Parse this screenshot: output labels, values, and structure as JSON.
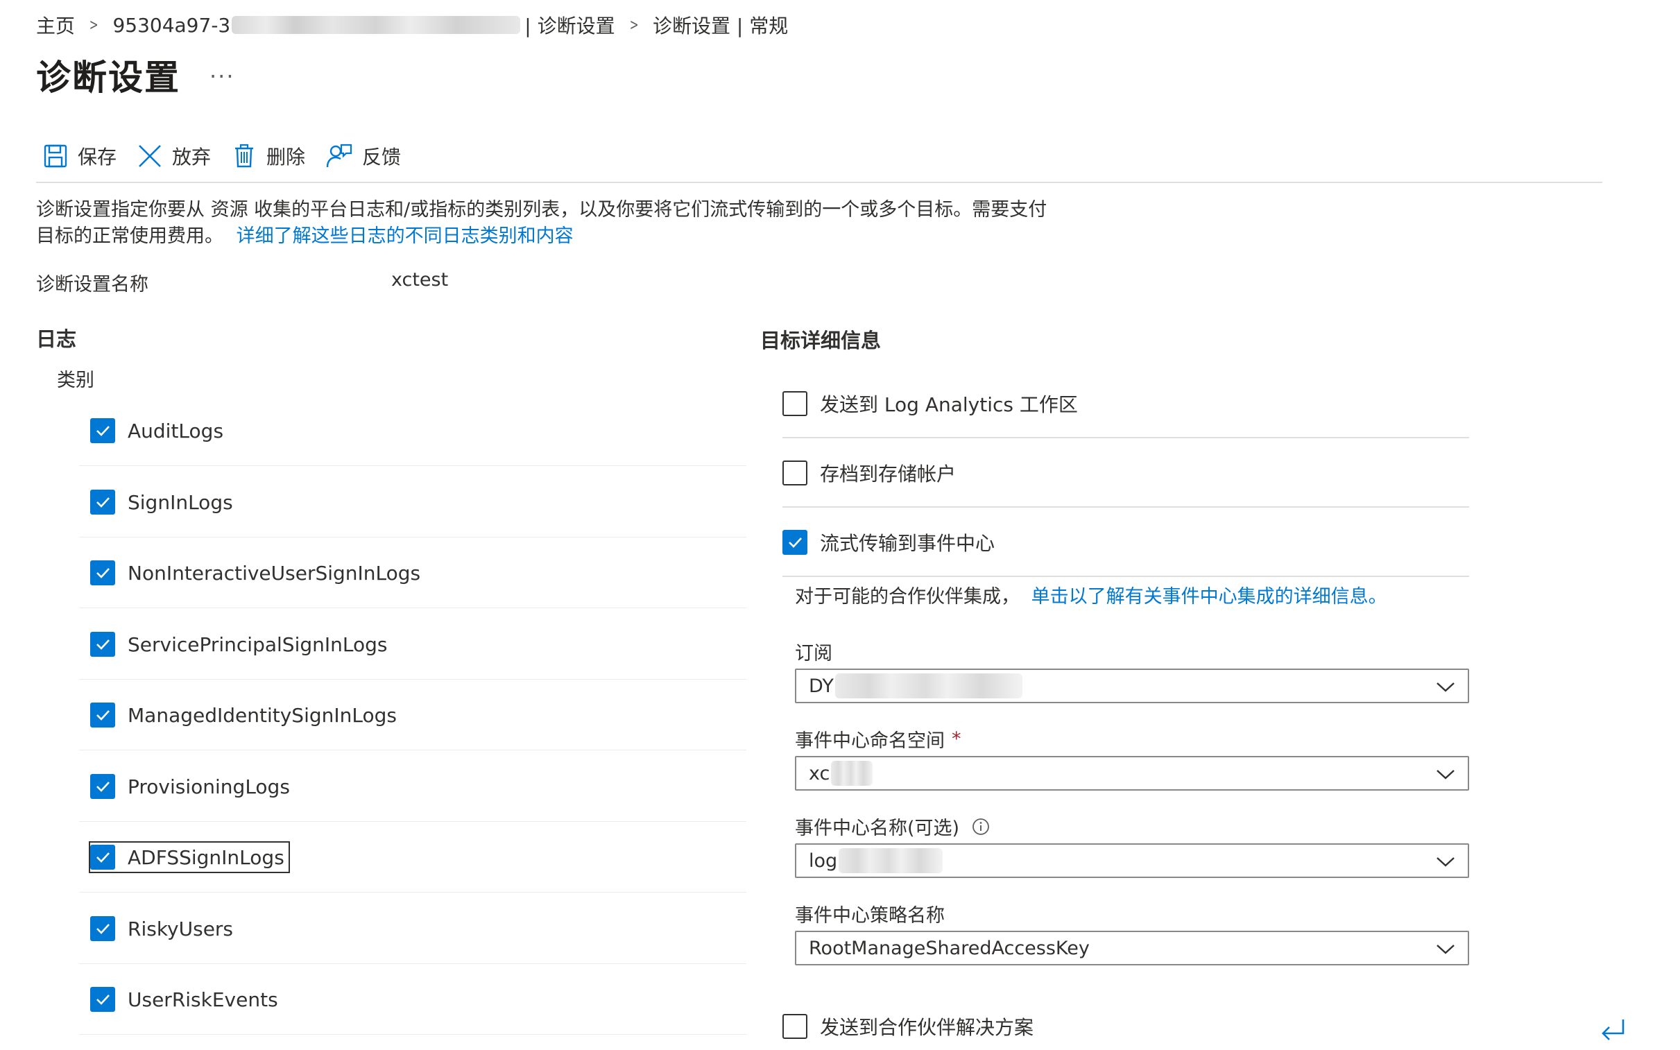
{
  "breadcrumb": {
    "home": "主页",
    "resource_prefix": "95304a97-3",
    "resource_suffix": "| 诊断设置",
    "current": "诊断设置 | 常规"
  },
  "page": {
    "title": "诊断设置",
    "more": "..."
  },
  "toolbar": {
    "save": "保存",
    "discard": "放弃",
    "delete": "删除",
    "feedback": "反馈"
  },
  "description": {
    "text": "诊断设置指定你要从 资源 收集的平台日志和/或指标的类别列表，以及你要将它们流式传输到的一个或多个目标。需要支付目标的正常使用费用。",
    "link": "详细了解这些日志的不同日志类别和内容"
  },
  "setting_name": {
    "label": "诊断设置名称",
    "value": "xctest"
  },
  "logs": {
    "title": "日志",
    "category_label": "类别",
    "items": [
      {
        "label": "AuditLogs",
        "checked": true
      },
      {
        "label": "SignInLogs",
        "checked": true
      },
      {
        "label": "NonInteractiveUserSignInLogs",
        "checked": true
      },
      {
        "label": "ServicePrincipalSignInLogs",
        "checked": true
      },
      {
        "label": "ManagedIdentitySignInLogs",
        "checked": true
      },
      {
        "label": "ProvisioningLogs",
        "checked": true
      },
      {
        "label": "ADFSSignInLogs",
        "checked": true
      },
      {
        "label": "RiskyUsers",
        "checked": true
      },
      {
        "label": "UserRiskEvents",
        "checked": true
      }
    ]
  },
  "destination": {
    "title": "目标详细信息",
    "log_analytics": {
      "label": "发送到 Log Analytics 工作区",
      "checked": false
    },
    "storage": {
      "label": "存档到存储帐户",
      "checked": false
    },
    "event_hub": {
      "label": "流式传输到事件中心",
      "checked": true
    },
    "partner_text": "对于可能的合作伙伴集成，",
    "partner_link": "单击以了解有关事件中心集成的详细信息。",
    "subscription": {
      "label": "订阅",
      "value": "DY"
    },
    "namespace": {
      "label": "事件中心命名空间",
      "required": "*",
      "value": "xc"
    },
    "hub_name": {
      "label": "事件中心名称(可选)",
      "value": "log"
    },
    "policy": {
      "label": "事件中心策略名称",
      "value": "RootManageSharedAccessKey"
    },
    "partner_solution": {
      "label": "发送到合作伙伴解决方案",
      "checked": false
    }
  },
  "colors": {
    "accent": "#0078d4",
    "text": "#323130",
    "required": "#a4262c"
  }
}
